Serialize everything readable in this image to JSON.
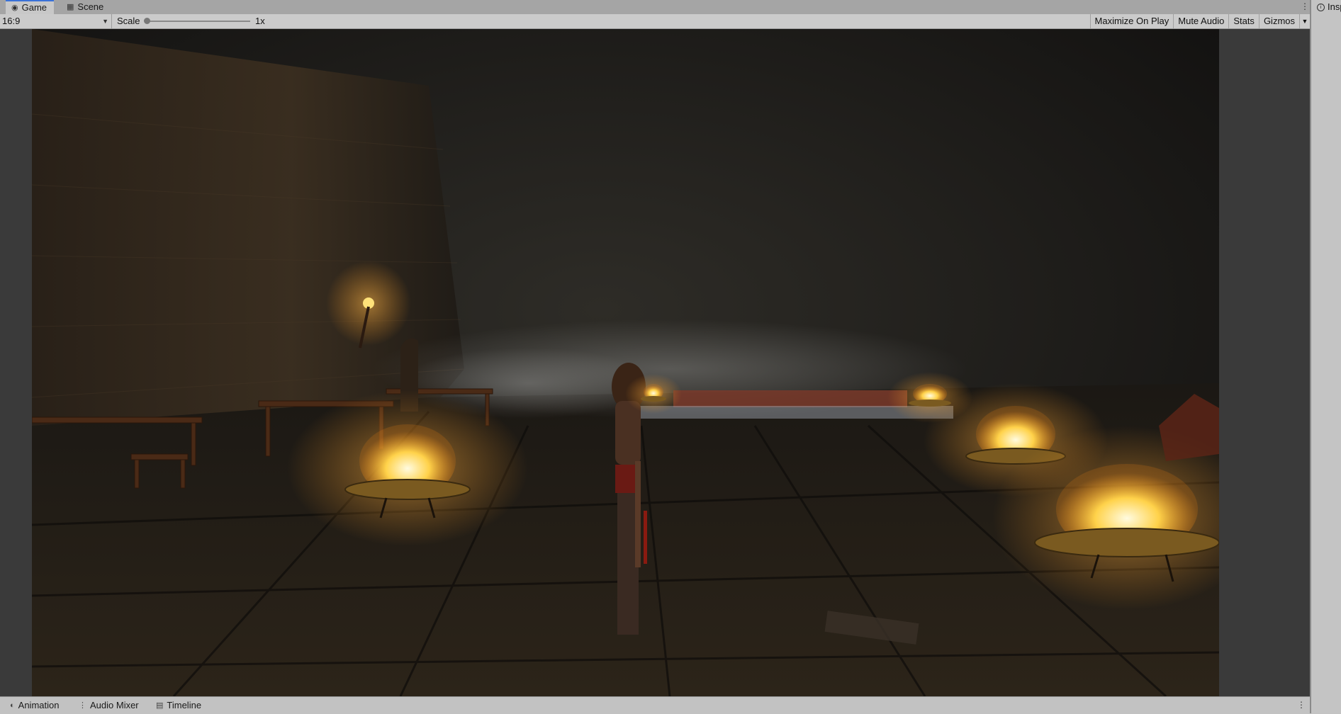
{
  "tabs": [
    {
      "label": "Game",
      "icon": "gamepad-icon",
      "active": true
    },
    {
      "label": "Scene",
      "icon": "grid-icon",
      "active": false
    }
  ],
  "toolbar": {
    "aspect": "16:9",
    "scale_label": "Scale",
    "scale_value": "1x",
    "maximize_on_play": "Maximize On Play",
    "mute_audio": "Mute Audio",
    "stats": "Stats",
    "gizmos": "Gizmos"
  },
  "inspector": {
    "tab_label": "Insp"
  },
  "bottom_tabs": [
    {
      "label": "Animation",
      "icon": "animation-icon"
    },
    {
      "label": "Audio Mixer",
      "icon": "mixer-icon"
    },
    {
      "label": "Timeline",
      "icon": "timeline-icon"
    }
  ],
  "colors": {
    "fire": "#ffd24a",
    "accent_tab": "#3a72d8",
    "panel": "#c2c2c2"
  }
}
